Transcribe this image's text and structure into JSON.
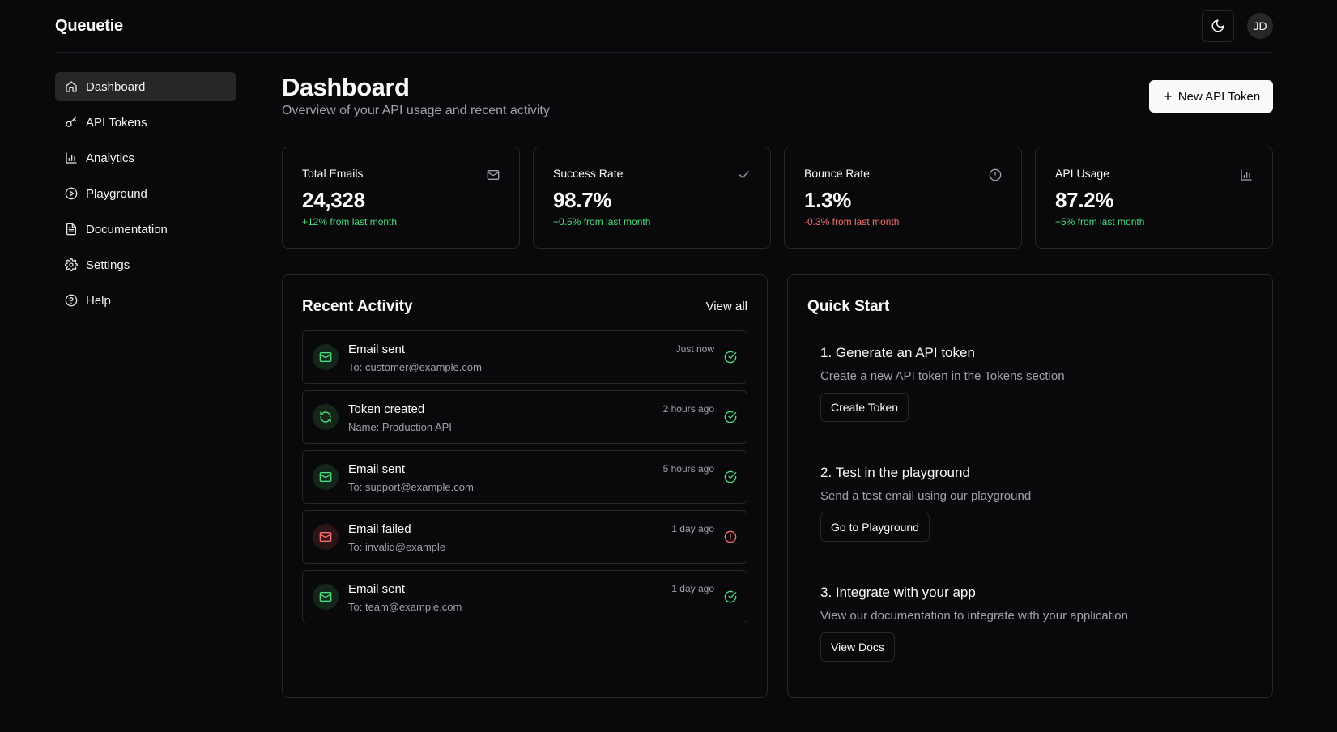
{
  "header": {
    "brand": "Queuetie",
    "avatar_initials": "JD",
    "theme_icon": "moon-icon"
  },
  "sidebar": {
    "items": [
      {
        "label": "Dashboard",
        "icon": "home-icon",
        "active": true
      },
      {
        "label": "API Tokens",
        "icon": "key-icon"
      },
      {
        "label": "Analytics",
        "icon": "bar-chart-icon"
      },
      {
        "label": "Playground",
        "icon": "play-circle-icon"
      },
      {
        "label": "Documentation",
        "icon": "file-text-icon"
      },
      {
        "label": "Settings",
        "icon": "gear-icon"
      },
      {
        "label": "Help",
        "icon": "help-circle-icon"
      }
    ]
  },
  "page": {
    "title": "Dashboard",
    "subtitle": "Overview of your API usage and recent activity",
    "new_token_label": "New API Token"
  },
  "stats": [
    {
      "label": "Total Emails",
      "value": "24,328",
      "change": "+12% from last month",
      "trend": "up",
      "icon": "mail-icon"
    },
    {
      "label": "Success Rate",
      "value": "98.7%",
      "change": "+0.5% from last month",
      "trend": "up",
      "icon": "check-icon"
    },
    {
      "label": "Bounce Rate",
      "value": "1.3%",
      "change": "-0.3% from last month",
      "trend": "down",
      "icon": "alert-circle-icon"
    },
    {
      "label": "API Usage",
      "value": "87.2%",
      "change": "+5% from last month",
      "trend": "up",
      "icon": "bar-chart-icon"
    }
  ],
  "activity": {
    "title": "Recent Activity",
    "view_all": "View all",
    "items": [
      {
        "title": "Email sent",
        "sub": "To: customer@example.com",
        "time": "Just now",
        "status": "ok",
        "icon": "mail-icon"
      },
      {
        "title": "Token created",
        "sub": "Name: Production API",
        "time": "2 hours ago",
        "status": "ok",
        "icon": "refresh-icon"
      },
      {
        "title": "Email sent",
        "sub": "To: support@example.com",
        "time": "5 hours ago",
        "status": "ok",
        "icon": "mail-icon"
      },
      {
        "title": "Email failed",
        "sub": "To: invalid@example",
        "time": "1 day ago",
        "status": "bad",
        "icon": "mail-icon"
      },
      {
        "title": "Email sent",
        "sub": "To: team@example.com",
        "time": "1 day ago",
        "status": "ok",
        "icon": "mail-icon"
      }
    ]
  },
  "quick_start": {
    "title": "Quick Start",
    "steps": [
      {
        "title": "1. Generate an API token",
        "desc": "Create a new API token in the Tokens section",
        "button": "Create Token"
      },
      {
        "title": "2. Test in the playground",
        "desc": "Send a test email using our playground",
        "button": "Go to Playground"
      },
      {
        "title": "3. Integrate with your app",
        "desc": "View our documentation to integrate with your application",
        "button": "View Docs"
      }
    ]
  },
  "colors": {
    "background": "#09090b",
    "border": "#27272a",
    "success": "#4ade80",
    "danger": "#f87171",
    "muted": "#a1a1aa"
  }
}
